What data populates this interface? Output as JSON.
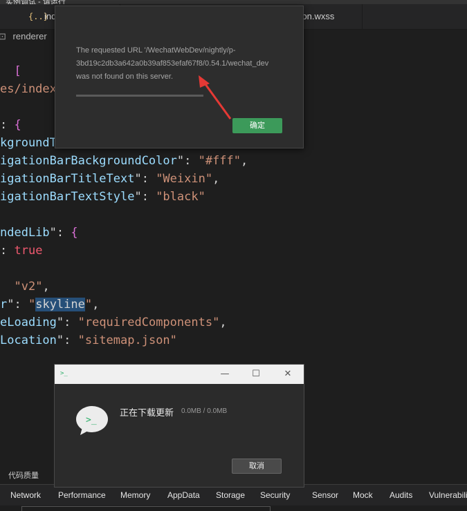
{
  "window": {
    "title": "实例调试 - 请运行"
  },
  "tabs": [
    {
      "icon": "{..}",
      "label": "ind"
    },
    {
      "label": "utton.wxss"
    }
  ],
  "breadcrumb": {
    "icon": "⊡",
    "label": "renderer"
  },
  "code_lines": [
    [
      [
        "p",
        "  "
      ],
      [
        "b",
        "["
      ]
    ],
    [
      [
        "s",
        "es/index"
      ]
    ],
    [],
    [
      [
        "p",
        ": "
      ],
      [
        "b",
        "{"
      ]
    ],
    [
      [
        "k",
        "kgroundT"
      ],
      [
        "p",
        "                                   "
      ]
    ],
    [
      [
        "k",
        "igationBarBackgroundColor"
      ],
      [
        "p",
        "\": "
      ],
      [
        "s",
        "\"#fff\""
      ],
      [
        "p",
        ","
      ]
    ],
    [
      [
        "k",
        "igationBarTitleText"
      ],
      [
        "p",
        "\": "
      ],
      [
        "s",
        "\"Weixin\""
      ],
      [
        "p",
        ","
      ]
    ],
    [
      [
        "k",
        "igationBarTextStyle"
      ],
      [
        "p",
        "\": "
      ],
      [
        "s",
        "\"black\""
      ]
    ],
    [],
    [
      [
        "k",
        "ndedLib"
      ],
      [
        "p",
        "\": "
      ],
      [
        "b",
        "{"
      ]
    ],
    [
      [
        "p",
        ": "
      ],
      [
        "t",
        "true"
      ]
    ],
    [],
    [
      [
        "p",
        "  "
      ],
      [
        "s",
        "\"v2\""
      ],
      [
        "p",
        ","
      ]
    ],
    [
      [
        "k",
        "r"
      ],
      [
        "p",
        "\": "
      ],
      [
        "s",
        "\""
      ],
      [
        "sel",
        "skyline"
      ],
      [
        "s",
        "\""
      ],
      [
        "p",
        ","
      ]
    ],
    [
      [
        "k",
        "eLoading"
      ],
      [
        "p",
        "\": "
      ],
      [
        "s",
        "\"requiredComponents\""
      ],
      [
        "p",
        ","
      ]
    ],
    [
      [
        "k",
        "Location"
      ],
      [
        "p",
        "\": "
      ],
      [
        "s",
        "\"sitemap.json\""
      ]
    ]
  ],
  "error_dialog": {
    "message_lines": [
      "The requested URL '/WechatWebDev/nightly/p-",
      "3bd19c2db3a642a0b39af853efaf67f8/0.54.1/wechat_dev",
      "was not found on this server."
    ],
    "ok_label": "确定"
  },
  "bottom_panel": {
    "code_quality_label": "代码质量",
    "devtools_tabs": [
      "Network",
      "Performance",
      "Memory",
      "AppData",
      "Storage",
      "Security",
      "Sensor",
      "Mock",
      "Audits",
      "Vulnerabili"
    ]
  },
  "update_dialog": {
    "logo_text": ">_",
    "controls": [
      "—",
      "☐",
      "✕"
    ],
    "status_text": "正在下载更新",
    "progress_text": "0.0MB / 0.0MB",
    "cancel_label": "取消"
  },
  "colors": {
    "accent_green": "#3c9a5a",
    "annotation_arrow": "#e53935"
  }
}
